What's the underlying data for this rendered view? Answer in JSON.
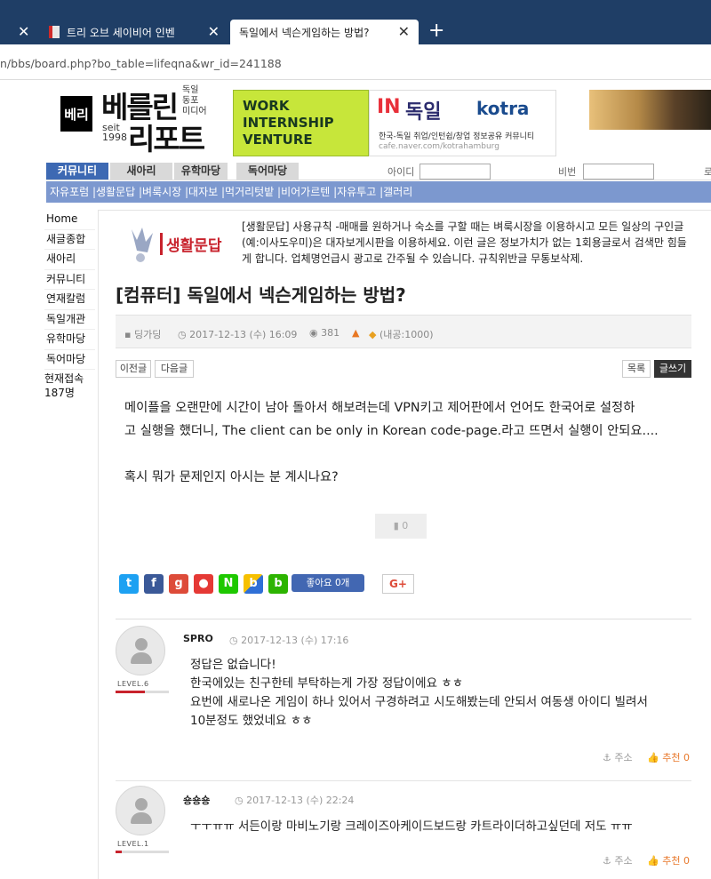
{
  "browser": {
    "tabs": [
      {
        "label": ""
      },
      {
        "label": "트리 오브 세이비어 인벤"
      },
      {
        "label": "독일에서 넥슨게임하는 방법?"
      }
    ],
    "close_glyph": "✕",
    "new_tab_glyph": "+",
    "url": "n/bbs/board.php?bo_table=lifeqna&wr_id=241188"
  },
  "site": {
    "logo_mark": "베리",
    "logo_name1": "베를린",
    "logo_name2": "리포트",
    "logo_small": [
      "독일",
      "동포",
      "미디어"
    ],
    "logo_seit": [
      "seit",
      "1998"
    ],
    "banner1": [
      "WORK",
      "INTERNSHIP",
      "VENTURE"
    ],
    "banner2": {
      "in": "IN",
      "de": "독일",
      "kotra": "kotra",
      "desc": "한국-독일 취업/인턴쉽/창업 정보공유 커뮤니티",
      "cafe": "cafe.naver.com/kotrahamburg"
    }
  },
  "nav": {
    "items": [
      "커뮤니티",
      "새아리",
      "유학마당",
      "독어마당"
    ],
    "id_label": "아이디",
    "pw_label": "비번",
    "extra": "로"
  },
  "subnav": "자유포럼 |생활문답 |벼룩시장 |대자보 |먹거리텃밭 |비어가르텐 |자유투고 |갤러리",
  "sidemenu": {
    "items": [
      "Home",
      "새글종합",
      "새아리",
      "커뮤니티",
      "연재칼럼",
      "독일개관",
      "유학마당",
      "독어마당"
    ],
    "online_label": "현재접속",
    "online_count": "187명"
  },
  "board": {
    "logo_title": "생활문답",
    "rules": "[생활문답] 사용규칙 -매매를 원하거나 숙소를 구할 때는 벼룩시장을 이용하시고 모든 일상의 구인글(예:이사도우미)은 대자보게시판을 이용하세요. 이런 글은 정보가치가 없는 1회용글로서 검색만 힘들게 합니다. 업체명언급시 광고로 간주될 수 있습니다. 규칙위반글 무통보삭제."
  },
  "post": {
    "title": "[컴퓨터] 독일에서 넥슨게임하는 방법?",
    "author": "딩가딩",
    "date": "2017-12-13 (수) 16:09",
    "views": "381",
    "points": "(내공:1000)",
    "prev_label": "이전글",
    "next_label": "다음글",
    "list_label": "목록",
    "write_label": "글쓰기",
    "body": [
      "메이플을 오랜만에 시간이 남아 돌아서 해보려는데 VPN키고 제어판에서 언어도 한국어로 설정하",
      "고 실행을 했더니, The client can be only in Korean code-page.라고 뜨면서 실행이 안되요....",
      "",
      "혹시 뭐가 문제인지 아시는 분 계시나요?"
    ],
    "likes": "0",
    "fb_like_label": "좋아요 0개",
    "gplus_label": "G+"
  },
  "comments": [
    {
      "name": "SPRO",
      "date": "2017-12-13 (수) 17:16",
      "level": "LEVEL.6",
      "level_fill": 0.55,
      "lines": [
        "정답은 없습니다!",
        "한국에있는 친구한테 부탁하는게 가장 정답이에요 ㅎㅎ",
        "요번에 새로나온 게임이 하나 있어서 구경하려고 시도해봤는데 안되서 여동생 아이디 빌려서",
        "10분정도 했었네요 ㅎㅎ"
      ],
      "address_label": "주소",
      "recommend_label": "추천 0"
    },
    {
      "name": "숑숑숑",
      "date": "2017-12-13 (수) 22:24",
      "level": "LEVEL.1",
      "level_fill": 0.12,
      "lines": [
        "ㅜㅜㅠㅠ 서든이랑 마비노기랑 크레이즈아케이드보드랑 카트라이더하고싶던데 저도 ㅠㅠ"
      ],
      "address_label": "주소",
      "recommend_label": "추천 0"
    }
  ],
  "colors": {
    "tabbar": "#1f3e66",
    "nav_active": "#3d69b3",
    "subnav": "#7c98cf",
    "accent_red": "#c8222c",
    "recommend": "#e8782b"
  }
}
